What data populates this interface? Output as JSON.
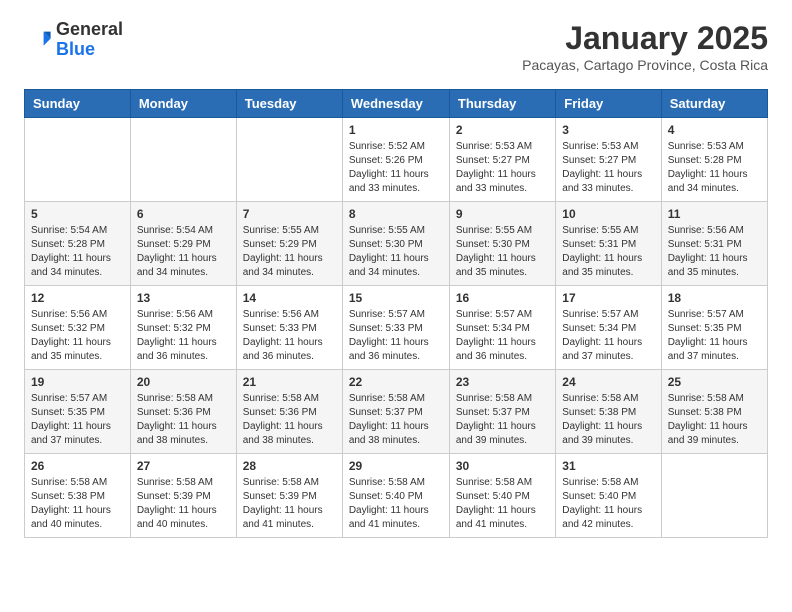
{
  "header": {
    "logo_general": "General",
    "logo_blue": "Blue",
    "month_title": "January 2025",
    "location": "Pacayas, Cartago Province, Costa Rica"
  },
  "weekdays": [
    "Sunday",
    "Monday",
    "Tuesday",
    "Wednesday",
    "Thursday",
    "Friday",
    "Saturday"
  ],
  "weeks": [
    [
      {
        "day": "",
        "info": ""
      },
      {
        "day": "",
        "info": ""
      },
      {
        "day": "",
        "info": ""
      },
      {
        "day": "1",
        "info": "Sunrise: 5:52 AM\nSunset: 5:26 PM\nDaylight: 11 hours and 33 minutes."
      },
      {
        "day": "2",
        "info": "Sunrise: 5:53 AM\nSunset: 5:27 PM\nDaylight: 11 hours and 33 minutes."
      },
      {
        "day": "3",
        "info": "Sunrise: 5:53 AM\nSunset: 5:27 PM\nDaylight: 11 hours and 33 minutes."
      },
      {
        "day": "4",
        "info": "Sunrise: 5:53 AM\nSunset: 5:28 PM\nDaylight: 11 hours and 34 minutes."
      }
    ],
    [
      {
        "day": "5",
        "info": "Sunrise: 5:54 AM\nSunset: 5:28 PM\nDaylight: 11 hours and 34 minutes."
      },
      {
        "day": "6",
        "info": "Sunrise: 5:54 AM\nSunset: 5:29 PM\nDaylight: 11 hours and 34 minutes."
      },
      {
        "day": "7",
        "info": "Sunrise: 5:55 AM\nSunset: 5:29 PM\nDaylight: 11 hours and 34 minutes."
      },
      {
        "day": "8",
        "info": "Sunrise: 5:55 AM\nSunset: 5:30 PM\nDaylight: 11 hours and 34 minutes."
      },
      {
        "day": "9",
        "info": "Sunrise: 5:55 AM\nSunset: 5:30 PM\nDaylight: 11 hours and 35 minutes."
      },
      {
        "day": "10",
        "info": "Sunrise: 5:55 AM\nSunset: 5:31 PM\nDaylight: 11 hours and 35 minutes."
      },
      {
        "day": "11",
        "info": "Sunrise: 5:56 AM\nSunset: 5:31 PM\nDaylight: 11 hours and 35 minutes."
      }
    ],
    [
      {
        "day": "12",
        "info": "Sunrise: 5:56 AM\nSunset: 5:32 PM\nDaylight: 11 hours and 35 minutes."
      },
      {
        "day": "13",
        "info": "Sunrise: 5:56 AM\nSunset: 5:32 PM\nDaylight: 11 hours and 36 minutes."
      },
      {
        "day": "14",
        "info": "Sunrise: 5:56 AM\nSunset: 5:33 PM\nDaylight: 11 hours and 36 minutes."
      },
      {
        "day": "15",
        "info": "Sunrise: 5:57 AM\nSunset: 5:33 PM\nDaylight: 11 hours and 36 minutes."
      },
      {
        "day": "16",
        "info": "Sunrise: 5:57 AM\nSunset: 5:34 PM\nDaylight: 11 hours and 36 minutes."
      },
      {
        "day": "17",
        "info": "Sunrise: 5:57 AM\nSunset: 5:34 PM\nDaylight: 11 hours and 37 minutes."
      },
      {
        "day": "18",
        "info": "Sunrise: 5:57 AM\nSunset: 5:35 PM\nDaylight: 11 hours and 37 minutes."
      }
    ],
    [
      {
        "day": "19",
        "info": "Sunrise: 5:57 AM\nSunset: 5:35 PM\nDaylight: 11 hours and 37 minutes."
      },
      {
        "day": "20",
        "info": "Sunrise: 5:58 AM\nSunset: 5:36 PM\nDaylight: 11 hours and 38 minutes."
      },
      {
        "day": "21",
        "info": "Sunrise: 5:58 AM\nSunset: 5:36 PM\nDaylight: 11 hours and 38 minutes."
      },
      {
        "day": "22",
        "info": "Sunrise: 5:58 AM\nSunset: 5:37 PM\nDaylight: 11 hours and 38 minutes."
      },
      {
        "day": "23",
        "info": "Sunrise: 5:58 AM\nSunset: 5:37 PM\nDaylight: 11 hours and 39 minutes."
      },
      {
        "day": "24",
        "info": "Sunrise: 5:58 AM\nSunset: 5:38 PM\nDaylight: 11 hours and 39 minutes."
      },
      {
        "day": "25",
        "info": "Sunrise: 5:58 AM\nSunset: 5:38 PM\nDaylight: 11 hours and 39 minutes."
      }
    ],
    [
      {
        "day": "26",
        "info": "Sunrise: 5:58 AM\nSunset: 5:38 PM\nDaylight: 11 hours and 40 minutes."
      },
      {
        "day": "27",
        "info": "Sunrise: 5:58 AM\nSunset: 5:39 PM\nDaylight: 11 hours and 40 minutes."
      },
      {
        "day": "28",
        "info": "Sunrise: 5:58 AM\nSunset: 5:39 PM\nDaylight: 11 hours and 41 minutes."
      },
      {
        "day": "29",
        "info": "Sunrise: 5:58 AM\nSunset: 5:40 PM\nDaylight: 11 hours and 41 minutes."
      },
      {
        "day": "30",
        "info": "Sunrise: 5:58 AM\nSunset: 5:40 PM\nDaylight: 11 hours and 41 minutes."
      },
      {
        "day": "31",
        "info": "Sunrise: 5:58 AM\nSunset: 5:40 PM\nDaylight: 11 hours and 42 minutes."
      },
      {
        "day": "",
        "info": ""
      }
    ]
  ]
}
